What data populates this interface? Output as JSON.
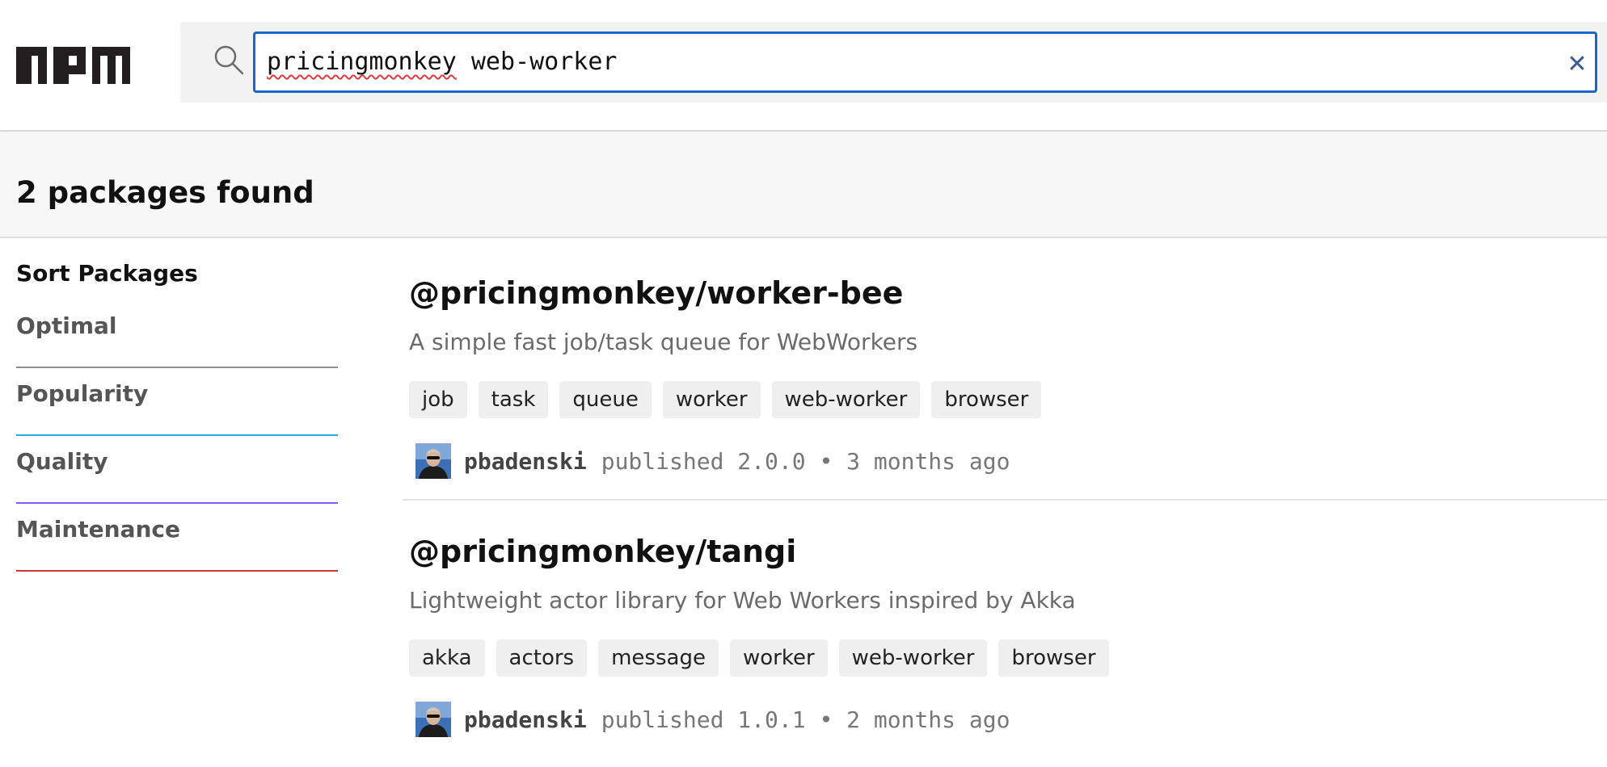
{
  "search": {
    "query_word1": "pricingmonkey",
    "query_rest": " web-worker",
    "clear_symbol": "✕"
  },
  "results": {
    "count_text": "2 packages found"
  },
  "sort": {
    "heading": "Sort Packages",
    "options": [
      {
        "label": "Optimal",
        "color": "#8e8e8e"
      },
      {
        "label": "Popularity",
        "color": "#29abe2"
      },
      {
        "label": "Quality",
        "color": "#8956ff"
      },
      {
        "label": "Maintenance",
        "color": "#cb3837"
      }
    ]
  },
  "packages": [
    {
      "name": "@pricingmonkey/worker-bee",
      "description": "A simple fast job/task queue for WebWorkers",
      "keywords": [
        "job",
        "task",
        "queue",
        "worker",
        "web-worker",
        "browser"
      ],
      "publisher": "pbadenski",
      "published_text": "published 2.0.0 • 3 months ago"
    },
    {
      "name": "@pricingmonkey/tangi",
      "description": "Lightweight actor library for Web Workers inspired by Akka",
      "keywords": [
        "akka",
        "actors",
        "message",
        "worker",
        "web-worker",
        "browser"
      ],
      "publisher": "pbadenski",
      "published_text": "published 1.0.1 • 2 months ago"
    }
  ],
  "colors": {
    "brand_logo": "#231f20",
    "focus_border": "#1b66c9"
  },
  "icons": {
    "logo": "npm-logo",
    "search": "search-icon",
    "clear": "close-icon",
    "avatar": "avatar"
  }
}
